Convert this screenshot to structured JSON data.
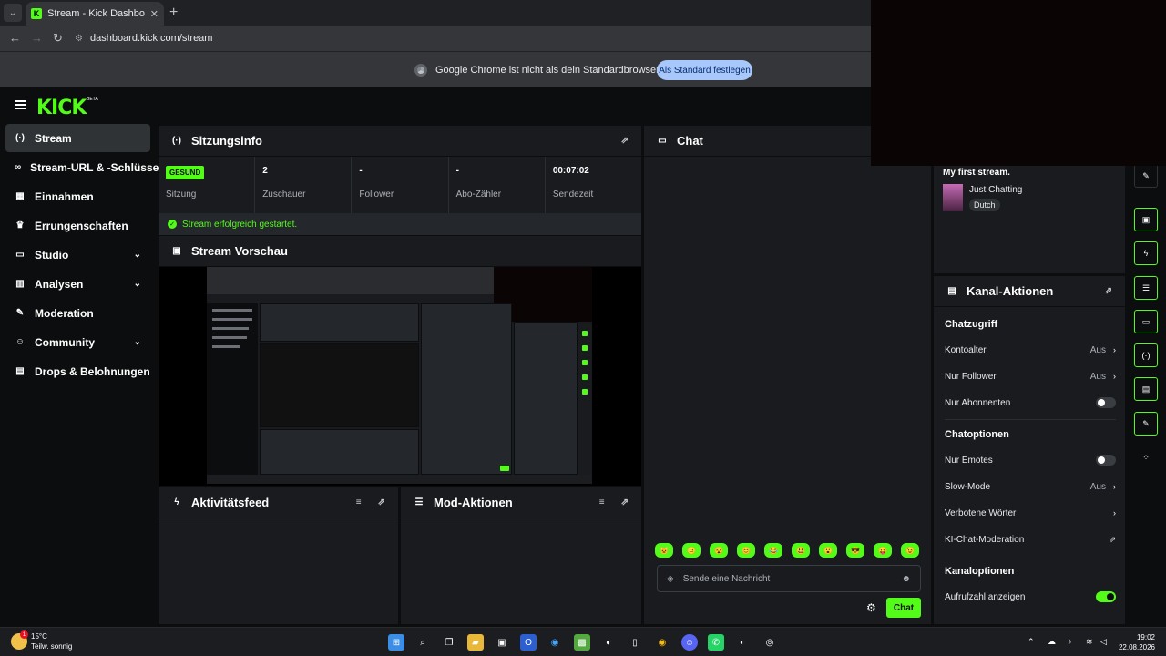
{
  "browser": {
    "tab_title": "Stream - Kick Dashboard",
    "tab_favicon": "K",
    "url": "dashboard.kick.com/stream",
    "infobar_text": "Google Chrome ist nicht als dein Standardbrowser festgelegt",
    "infobar_button": "Als Standard festlegen"
  },
  "brand": {
    "logo": "KICK",
    "beta": "BETA",
    "accent": "#53fc18"
  },
  "sidebar": {
    "items": [
      {
        "label": "Stream",
        "icon": "broadcast-icon",
        "glyph": "(·)",
        "active": true,
        "chevron": false
      },
      {
        "label": "Stream-URL & -Schlüssel",
        "icon": "link-icon",
        "glyph": "🔗",
        "chevron": false
      },
      {
        "label": "Einnahmen",
        "icon": "chart-icon",
        "glyph": "▦",
        "chevron": false
      },
      {
        "label": "Errungenschaften",
        "icon": "trophy-icon",
        "glyph": "🏆",
        "chevron": false
      },
      {
        "label": "Studio",
        "icon": "studio-icon",
        "glyph": "▭",
        "chevron": true
      },
      {
        "label": "Analysen",
        "icon": "analytics-icon",
        "glyph": "📈",
        "chevron": true
      },
      {
        "label": "Moderation",
        "icon": "wrench-icon",
        "glyph": "🔧",
        "chevron": false
      },
      {
        "label": "Community",
        "icon": "users-icon",
        "glyph": "👥",
        "chevron": true
      },
      {
        "label": "Drops & Belohnungen",
        "icon": "gift-icon",
        "glyph": "🎁",
        "chevron": false
      }
    ]
  },
  "session": {
    "title": "Sitzungsinfo",
    "status_badge": "GESUND",
    "stats": [
      {
        "value": "",
        "label": "Sitzung"
      },
      {
        "value": "2",
        "label": "Zuschauer"
      },
      {
        "value": "-",
        "label": "Follower"
      },
      {
        "value": "-",
        "label": "Abo-Zähler"
      },
      {
        "value": "00:07:02",
        "label": "Sendezeit"
      }
    ],
    "success_message": "Stream erfolgreich gestartet."
  },
  "preview": {
    "title": "Stream Vorschau"
  },
  "activity": {
    "title": "Aktivitätsfeed"
  },
  "mod_actions": {
    "title": "Mod-Aktionen"
  },
  "chat": {
    "title": "Chat",
    "input_placeholder": "Sende eine Nachricht",
    "send_label": "Chat",
    "emotes": [
      "😺",
      "😐",
      "😵",
      "😊",
      "😂",
      "😃",
      "😮",
      "😎",
      "😛",
      "😉"
    ]
  },
  "stream_info": {
    "title": "My first stream.",
    "category": "Just Chatting",
    "language": "Dutch"
  },
  "channel_actions": {
    "title": "Kanal-Aktionen",
    "chat_access": {
      "heading": "Chatzugriff",
      "account_age": {
        "label": "Kontoalter",
        "value": "Aus"
      },
      "followers_only": {
        "label": "Nur Follower",
        "value": "Aus"
      },
      "subscribers_only": {
        "label": "Nur Abonnenten"
      }
    },
    "chat_options": {
      "heading": "Chatoptionen",
      "emotes_only": {
        "label": "Nur Emotes"
      },
      "slow_mode": {
        "label": "Slow-Mode",
        "value": "Aus"
      },
      "banned_words": {
        "label": "Verbotene Wörter"
      },
      "ai_moderation": {
        "label": "KI-Chat-Moderation"
      }
    },
    "channel_options": {
      "heading": "Kanaloptionen",
      "show_viewcount": {
        "label": "Aufrufzahl anzeigen"
      }
    }
  },
  "taskbar": {
    "temperature": "15°C",
    "condition": "Teilw. sonnig",
    "weather_badge": "1",
    "time": "19:02",
    "date": "22.08.2026"
  }
}
